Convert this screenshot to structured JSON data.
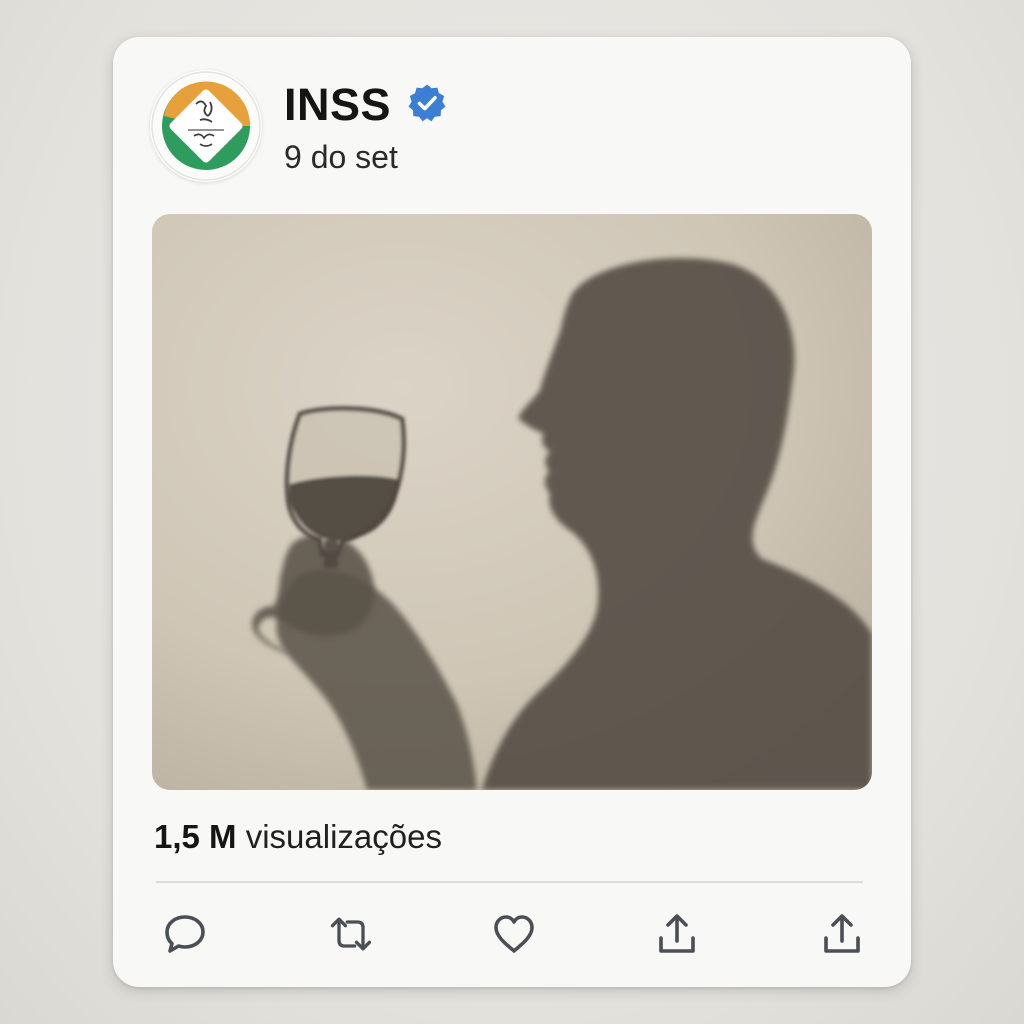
{
  "post": {
    "author": {
      "name": "INSS",
      "verified": true,
      "avatar_icon": "inss-logo-icon"
    },
    "date": "9 do set",
    "media": {
      "type": "photo",
      "content": "shadow-silhouette-wine-glass"
    },
    "views": {
      "count": "1,5 M",
      "label": "visualizações"
    },
    "actions": [
      {
        "name": "reply",
        "icon": "comment-icon"
      },
      {
        "name": "repost",
        "icon": "repost-icon"
      },
      {
        "name": "like",
        "icon": "heart-icon"
      },
      {
        "name": "share",
        "icon": "share-icon"
      },
      {
        "name": "share-alt",
        "icon": "share-icon"
      }
    ]
  },
  "colors": {
    "background": "#e6e4df",
    "card": "#f8f8f7",
    "text": "#151515",
    "verified_badge": "#3a7fd5",
    "icon": "#4a4f55",
    "logo_green": "#2e9c5c",
    "logo_orange": "#e7a03a",
    "wall": "#cfc6b7",
    "shadow": "#534d44"
  }
}
